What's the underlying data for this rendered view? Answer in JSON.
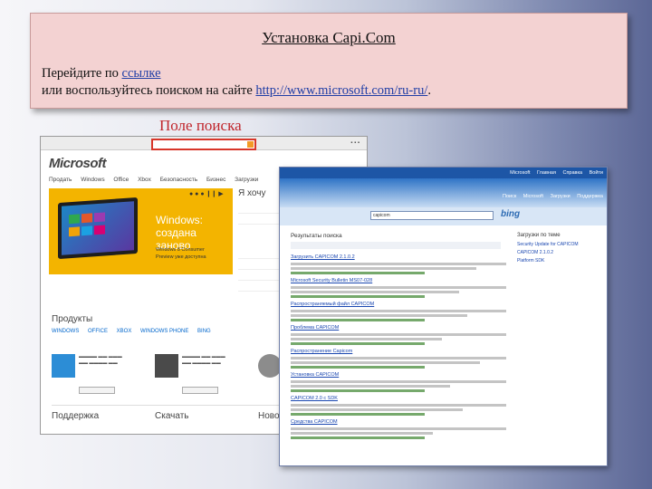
{
  "slide": {
    "title": "Установка Capi.Com",
    "line1_prefix": "Перейдите по ",
    "line1_link": "ссылке",
    "line2_prefix": "или воспользуйтесь поиском на сайте ",
    "line2_link": "http://www.microsoft.com/ru-ru/",
    "line2_suffix": ".",
    "search_caption": "Поле поиска"
  },
  "shot1": {
    "logo": "Microsoft",
    "nav": [
      "Продать",
      "Windows",
      "Office",
      "Xbox",
      "Безопасность",
      "Бизнес",
      "Загрузки"
    ],
    "hero_title_1": "Windows:",
    "hero_title_2": "создана заново",
    "hero_sub_1": "Windows 8 Consumer",
    "hero_sub_2": "Preview уже доступна",
    "side_title": "Я хочу",
    "products_title": "Продукты",
    "product_links": [
      "WINDOWS",
      "OFFICE",
      "XBOX",
      "WINDOWS PHONE",
      "BING"
    ],
    "bottom": [
      "Поддержка",
      "Скачать",
      "Новости"
    ],
    "colors": {
      "hero": "#f3b400",
      "search_highlight": "#d8362a"
    }
  },
  "shot2": {
    "top_links": [
      "Microsoft",
      "Главная",
      "Справка",
      "Войти"
    ],
    "header_links": [
      "Поиск",
      "Microsoft",
      "Загрузки",
      "Поддержка"
    ],
    "search_value": "capicom",
    "bing_label": "bing",
    "results_title": "Результаты поиска",
    "results": [
      "Загрузить CAPICOM 2.1.0.2",
      "Microsoft Security Bulletin MS07-028",
      "Распространяемый файл CAPICOM",
      "Проблема CAPICOM",
      "Распространение Capicom",
      "Установка CAPICOM",
      "CAPICOM 2.0 с SDK",
      "Средства CAPICOM"
    ],
    "right_title": "Загрузки по теме",
    "right_items": [
      "Security Update for CAPICOM",
      "CAPICOM 2.1.0.2",
      "Platform SDK"
    ]
  }
}
